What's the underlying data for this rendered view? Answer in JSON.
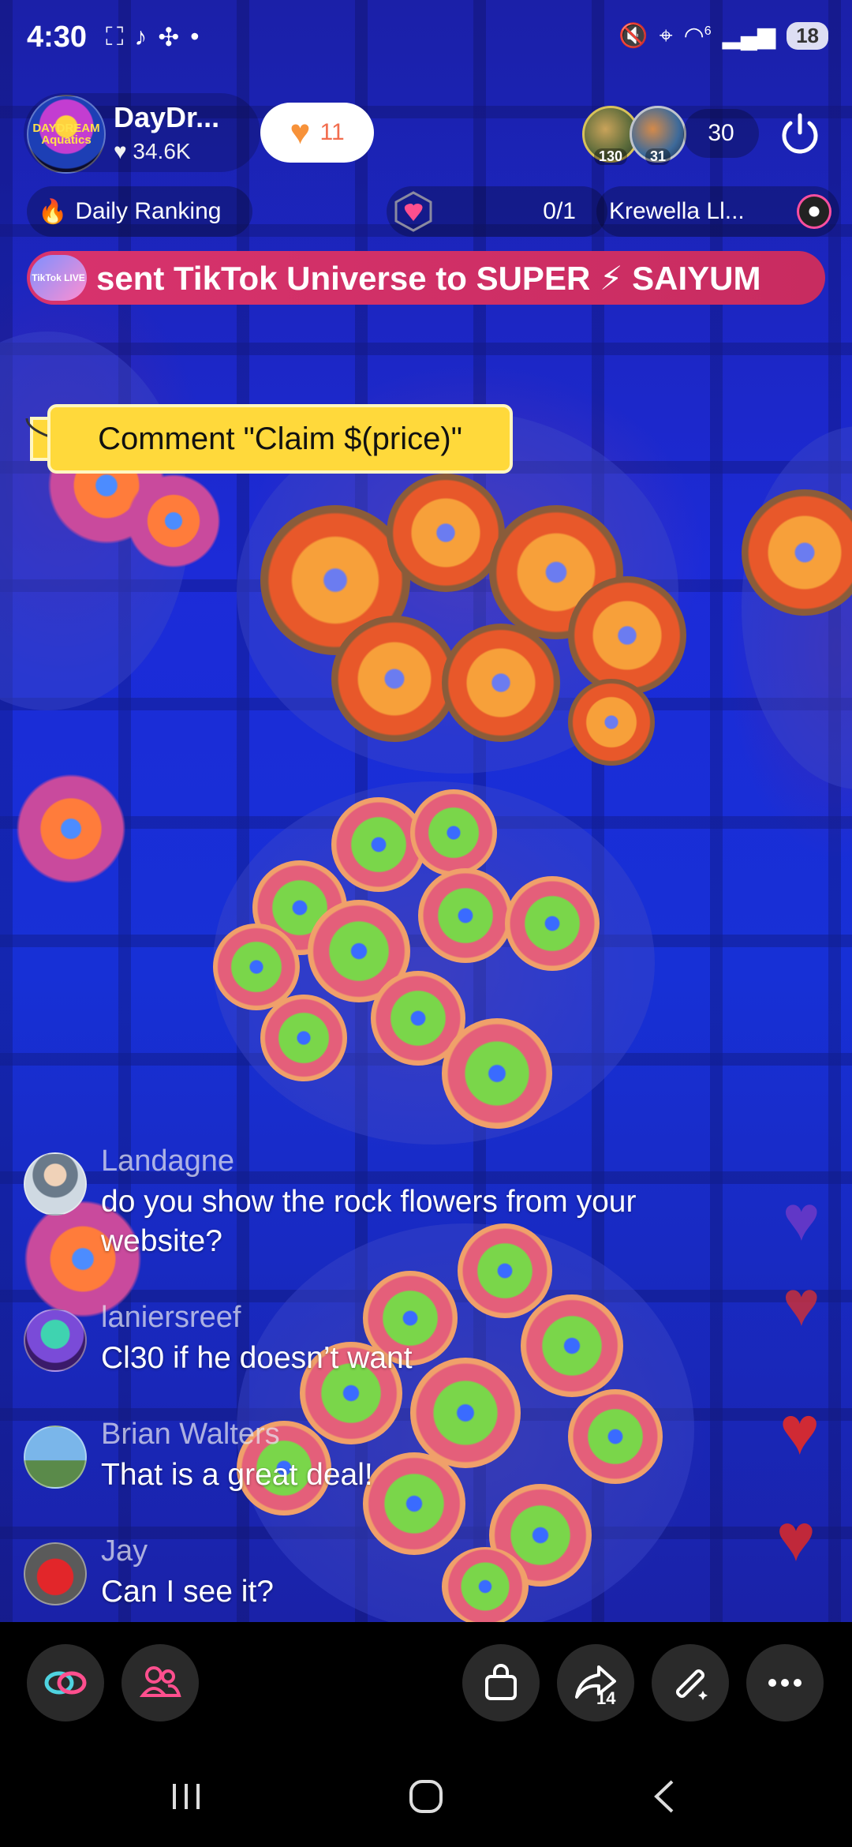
{
  "status_bar": {
    "time": "4:30",
    "network_label": "6",
    "battery": "18"
  },
  "host": {
    "name": "DayDr...",
    "likes": "34.6K",
    "avatar_text": "DAYDREAM Aquatics",
    "like_count": "11"
  },
  "viewers": {
    "avatar_1_badge": "130",
    "avatar_2_badge": "31",
    "count": "30"
  },
  "chips": {
    "ranking": "Daily Ranking",
    "match_progress": "0/1",
    "featured": "Krewella Ll..."
  },
  "banner": {
    "badge": "TikTok LIVE",
    "text": "sent TikTok Universe to SUPER ⚡ SAIYUM"
  },
  "comment_tag": {
    "text": "Comment \"Claim $(price)\""
  },
  "chat": [
    {
      "user": "Landagne",
      "text": "do you show the rock flowers from your website?"
    },
    {
      "user": "laniersreef",
      "text": "Cl30 if he doesn’t want"
    },
    {
      "user": "Brian Walters",
      "text": "That is a great deal!"
    },
    {
      "user": "Jay",
      "text": "Can I see it?"
    }
  ],
  "action_bar": {
    "share_count": "14"
  },
  "colors": {
    "accent_pink": "#d8336d",
    "tag_yellow": "#ffd93b",
    "heart_red": "#c8303c"
  }
}
